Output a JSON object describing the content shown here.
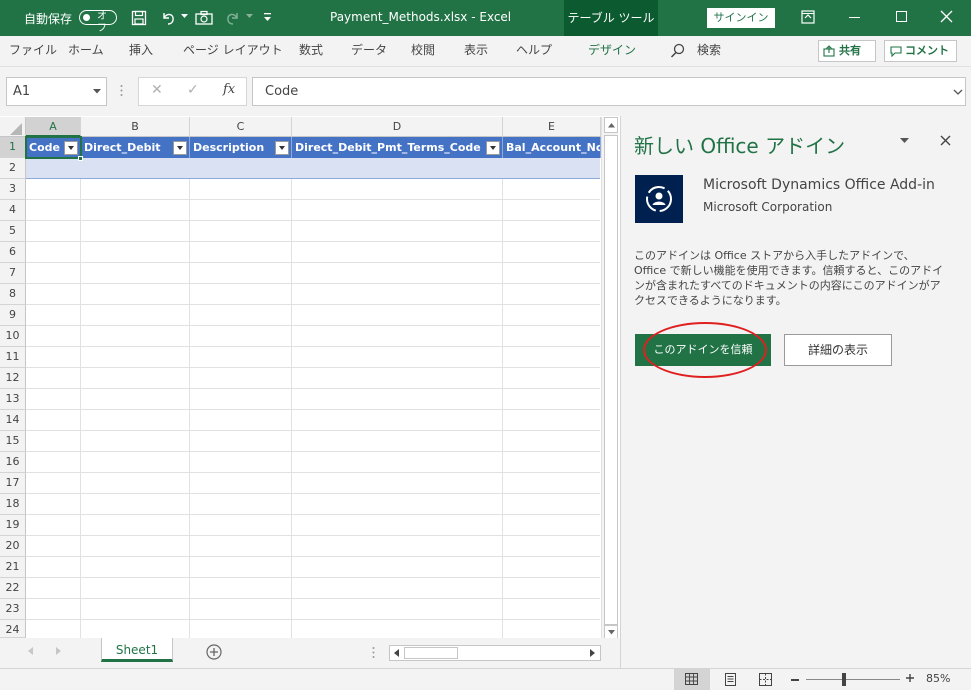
{
  "titlebar": {
    "autosave_label": "自動保存",
    "autosave_state": "オフ",
    "file_title": "Payment_Methods.xlsx  -  Excel",
    "context_tab": "テーブル ツール",
    "signin": "サインイン"
  },
  "ribbon": {
    "tabs": [
      "ファイル",
      "ホーム",
      "挿入",
      "ページ レイアウト",
      "数式",
      "データ",
      "校閲",
      "表示",
      "ヘルプ",
      "デザイン"
    ],
    "search_label": "検索",
    "share": "共有",
    "comment": "コメント"
  },
  "formula_bar": {
    "name_box": "A1",
    "cancel_glyph": "✕",
    "enter_glyph": "✓",
    "fx_glyph": "fx",
    "value": "Code"
  },
  "sheet": {
    "columns": [
      "A",
      "B",
      "C",
      "D",
      "E"
    ],
    "header_row": [
      "Code",
      "Direct_Debit",
      "Description",
      "Direct_Debit_Pmt_Terms_Code",
      "Bal_Account_No"
    ],
    "row_numbers": [
      "1",
      "2",
      "3",
      "4",
      "5",
      "6",
      "7",
      "8",
      "9",
      "10",
      "11",
      "12",
      "13",
      "14",
      "15",
      "16",
      "17",
      "18",
      "19",
      "20",
      "21",
      "22",
      "23",
      "24"
    ],
    "active_cell": "A1",
    "tab_name": "Sheet1"
  },
  "task_pane": {
    "title": "新しい Office アドイン",
    "addin_name": "Microsoft Dynamics Office Add-in",
    "publisher": "Microsoft Corporation",
    "description": "このアドインは Office ストアから入手したアドインで、Office で新しい機能を使用できます。信頼すると、このアドインが含まれたすべてのドキュメントの内容にこのアドインがアクセスできるようになります。",
    "trust_button": "このアドインを信頼",
    "details_button": "詳細の表示"
  },
  "statusbar": {
    "zoom": "85%"
  },
  "colors": {
    "excel_green": "#217346",
    "table_header_blue": "#4472c4",
    "annotation_red": "#e02020"
  }
}
